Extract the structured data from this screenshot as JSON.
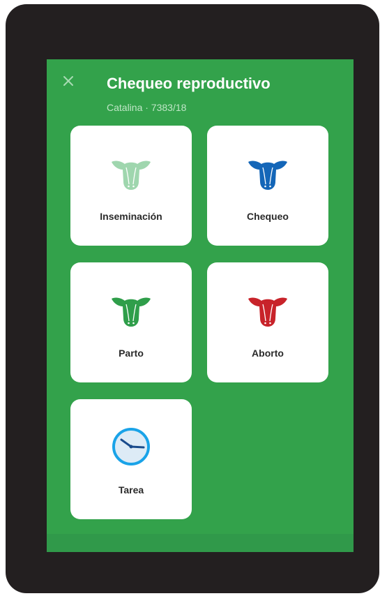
{
  "header": {
    "title": "Chequeo reproductivo",
    "subtitle": "Catalina · 7383/18"
  },
  "colors": {
    "background": "#33a24b",
    "inseminacion": "#9fd6ae",
    "chequeo": "#1466b8",
    "parto": "#2f9e4a",
    "aborto": "#c8232a",
    "tarea_ring": "#1aa3e8"
  },
  "tiles": [
    {
      "label": "Inseminación",
      "icon": "cow-icon"
    },
    {
      "label": "Chequeo",
      "icon": "cow-icon"
    },
    {
      "label": "Parto",
      "icon": "cow-icon"
    },
    {
      "label": "Aborto",
      "icon": "cow-icon"
    },
    {
      "label": "Tarea",
      "icon": "clock-icon"
    }
  ]
}
